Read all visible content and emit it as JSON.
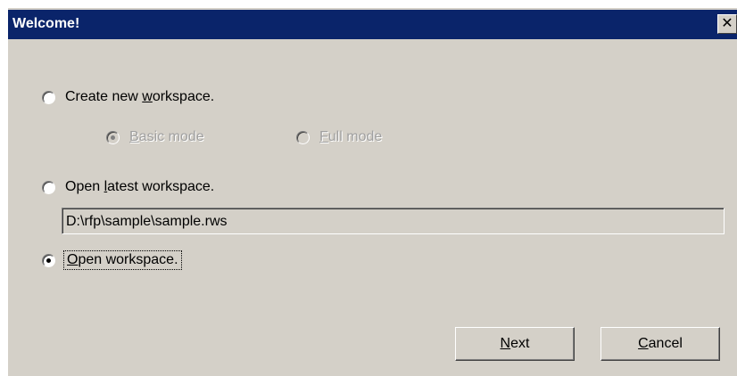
{
  "window": {
    "title": "Welcome!",
    "close_glyph": "✕"
  },
  "options": {
    "create_new": {
      "label_pre": "Create new ",
      "label_key": "w",
      "label_post": "orkspace.",
      "selected": false
    },
    "basic_mode": {
      "label_key": "B",
      "label_post": "asic mode",
      "selected": true,
      "enabled": false
    },
    "full_mode": {
      "label_key": "F",
      "label_post": "ull mode",
      "selected": false,
      "enabled": false
    },
    "open_latest": {
      "label_pre": "Open ",
      "label_key": "l",
      "label_post": "atest workspace.",
      "selected": false
    },
    "latest_path": "D:\\rfp\\sample\\sample.rws",
    "open_workspace": {
      "label_key": "O",
      "label_post": "pen workspace.",
      "selected": true
    }
  },
  "buttons": {
    "next": {
      "label_key": "N",
      "label_post": "ext"
    },
    "cancel": {
      "label_key": "C",
      "label_post": "ancel"
    }
  },
  "icons": {
    "close": "close-icon"
  }
}
